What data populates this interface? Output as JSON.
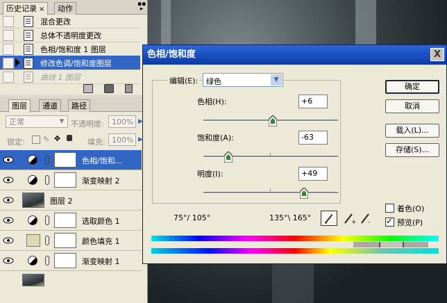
{
  "history_panel": {
    "tabs": [
      {
        "label": "历史记录",
        "close": "×"
      },
      {
        "label": "动作"
      }
    ],
    "items": [
      {
        "label": "混合更改"
      },
      {
        "label": "总体不透明度更改"
      },
      {
        "label": "色相/饱和度 1 图层"
      },
      {
        "label": "修改色调/饱和度图层"
      },
      {
        "label": "曲线 1 图层"
      }
    ],
    "selected_index": 3,
    "disabled_index": 4
  },
  "layers_panel": {
    "tabs": [
      {
        "label": "图层"
      },
      {
        "label": "通道"
      },
      {
        "label": "路径"
      }
    ],
    "blend_mode": "正常",
    "opacity_label": "不透明度:",
    "opacity_value": "100%",
    "lock_label": "锁定:",
    "fill_label": "填充:",
    "fill_value": "100%",
    "layers": [
      {
        "name": "色相/饱和...",
        "kind": "adjustment",
        "selected": true
      },
      {
        "name": "渐变映射 2",
        "kind": "adjustment"
      },
      {
        "name": "图层 2",
        "kind": "photo"
      },
      {
        "name": "选取颜色 1",
        "kind": "adjustment"
      },
      {
        "name": "颜色填充 1",
        "kind": "fill"
      },
      {
        "name": "渐变映射 1",
        "kind": "adjustment"
      }
    ]
  },
  "dialog": {
    "title": "色相/饱和度",
    "close_label": "X",
    "edit_label": "编辑(E):",
    "edit_value": "绿色",
    "hue": {
      "label": "色相(H):",
      "value": "+6",
      "level": 6,
      "min": -180,
      "max": 180
    },
    "saturation": {
      "label": "饱和度(A):",
      "value": "-63",
      "level": -63,
      "min": -100,
      "max": 100
    },
    "lightness": {
      "label": "明度(I):",
      "value": "+49",
      "level": 49,
      "min": -100,
      "max": 100
    },
    "range_left": "75°/ 105°",
    "range_right": "135°\\ 165°",
    "buttons": {
      "ok": "确定",
      "cancel": "取消",
      "load": "载入(L)...",
      "save": "存储(S)..."
    },
    "colorize": {
      "label": "着色(O)",
      "checked": false
    },
    "preview": {
      "label": "预览(P)",
      "checked": true
    },
    "colors": {
      "titlebar": "#0a3ba6",
      "selection": "#3166c4",
      "panel": "#ece9d8"
    }
  }
}
